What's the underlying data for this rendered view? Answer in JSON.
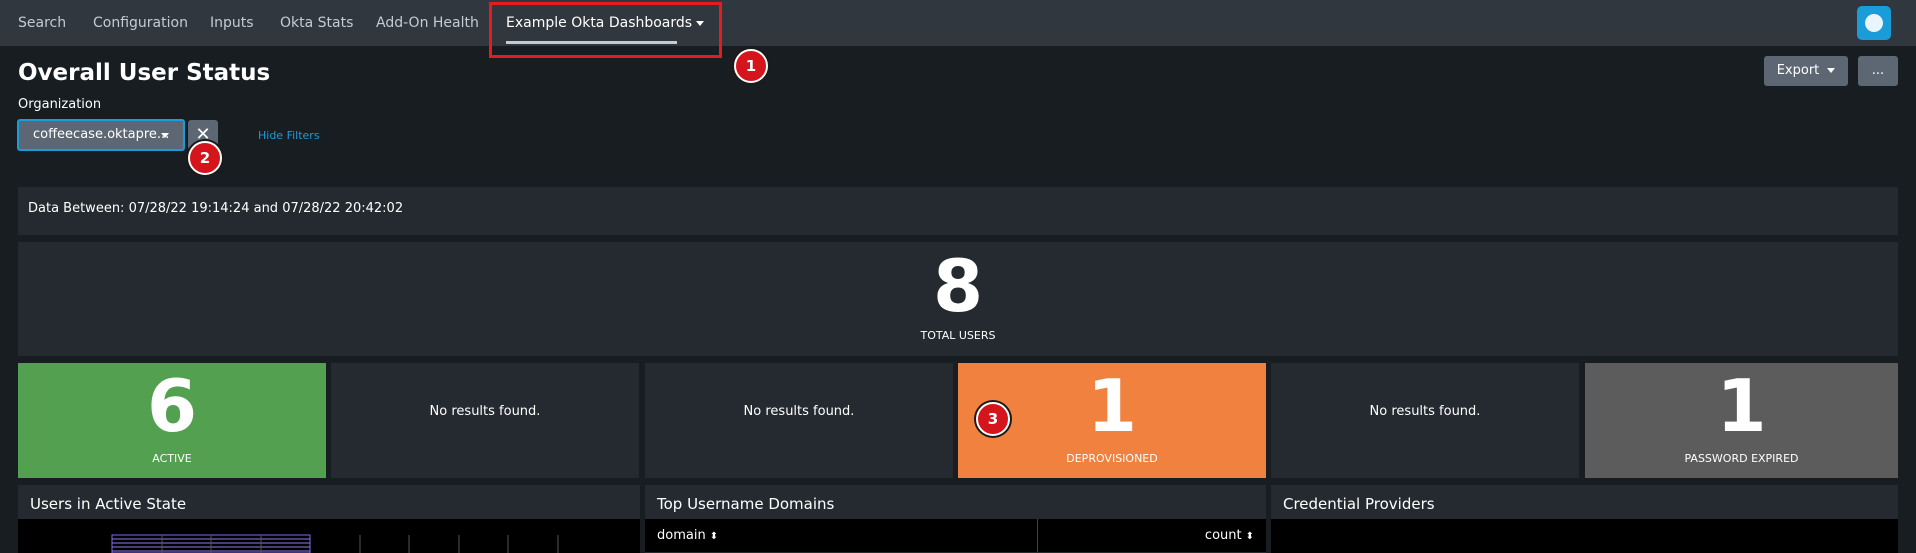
{
  "nav": {
    "items": [
      {
        "label": "Search"
      },
      {
        "label": "Configuration"
      },
      {
        "label": "Inputs"
      },
      {
        "label": "Okta Stats"
      },
      {
        "label": "Add-On Health"
      },
      {
        "label": "Example Okta Dashboards"
      }
    ],
    "active_index": 5
  },
  "annotations": {
    "badge1": "1",
    "badge2": "2",
    "badge3": "3",
    "highlight_color": "#e31d1d"
  },
  "header": {
    "title": "Overall User Status",
    "export_label": "Export",
    "more_label": "..."
  },
  "filters": {
    "label": "Organization",
    "selected": "coffeecase.oktapre...",
    "clear_symbol": "✕",
    "hide_label": "Hide Filters"
  },
  "data_between": "Data Between: 07/28/22 19:14:24 and 07/28/22 20:42:02",
  "total": {
    "value": "8",
    "label": "TOTAL USERS"
  },
  "status_tiles": [
    {
      "value": "6",
      "label": "ACTIVE",
      "color": "#53a051"
    },
    {
      "text": "No results found."
    },
    {
      "text": "No results found."
    },
    {
      "value": "1",
      "label": "DEPROVISIONED",
      "color": "#f1813f"
    },
    {
      "text": "No results found."
    },
    {
      "value": "1",
      "label": "PASSWORD EXPIRED",
      "color": "#5c5c5c"
    }
  ],
  "panels": {
    "active_state": {
      "title": "Users in Active State"
    },
    "domains": {
      "title": "Top Username Domains",
      "col_domain": "domain",
      "col_count": "count",
      "sort_symbol": "⬍"
    },
    "credential": {
      "title": "Credential Providers"
    }
  },
  "colors": {
    "accent": "#1a9cd9",
    "topbar": "#31373e",
    "background": "#171d21",
    "panel": "#242a2f"
  }
}
